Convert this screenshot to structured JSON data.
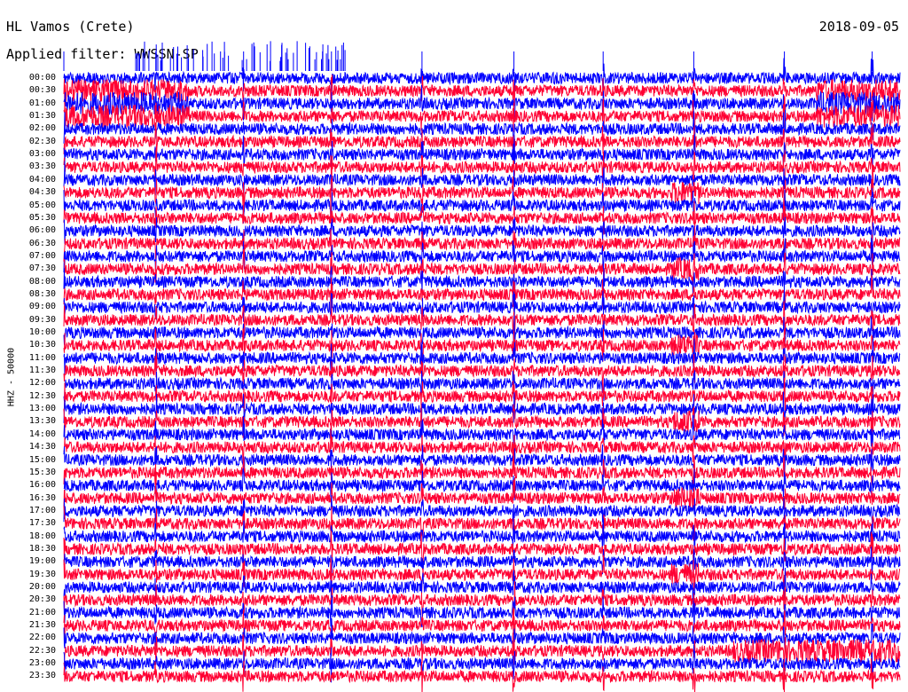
{
  "header": {
    "station": "HL Vamos (Crete)",
    "date": "2018-09-05",
    "filter": "Applied filter: WWSSN-SP"
  },
  "chart_data": {
    "type": "line",
    "title": "HL Vamos (Crete)",
    "subtitle": "Applied filter: WWSSN-SP",
    "date": "2018-09-05",
    "ylabel": "HHZ - 50000",
    "xlabel": "",
    "grid": false,
    "rows": [
      "00:00",
      "00:30",
      "01:00",
      "01:30",
      "02:00",
      "02:30",
      "03:00",
      "03:30",
      "04:00",
      "04:30",
      "05:00",
      "05:30",
      "06:00",
      "06:30",
      "07:00",
      "07:30",
      "08:00",
      "08:30",
      "09:00",
      "09:30",
      "10:00",
      "10:30",
      "11:00",
      "11:30",
      "12:00",
      "12:30",
      "13:00",
      "13:30",
      "14:00",
      "14:30",
      "15:00",
      "15:30",
      "16:00",
      "16:30",
      "17:00",
      "17:30",
      "18:00",
      "18:30",
      "19:00",
      "19:30",
      "20:00",
      "20:30",
      "21:00",
      "21:30",
      "22:00",
      "22:30",
      "23:00",
      "23:30"
    ],
    "trace_colors": [
      "#0000ff",
      "#ff0033"
    ],
    "periodic_spike_minutes": [
      0.0,
      3.3,
      6.45,
      9.6,
      12.85,
      16.15,
      19.35,
      22.6,
      25.85,
      29.0
    ],
    "noisy_segments": [
      {
        "rows": [
          1,
          2,
          3
        ],
        "start_min": 0.0,
        "end_min": 4.5
      },
      {
        "rows": [
          1,
          2,
          3
        ],
        "start_min": 27.0,
        "end_min": 30.0
      },
      {
        "rows": [
          9,
          15,
          21,
          27,
          33,
          39
        ],
        "start_min": 21.8,
        "end_min": 22.8
      },
      {
        "rows": [
          45
        ],
        "start_min": 24.0,
        "end_min": 30.0
      }
    ]
  }
}
